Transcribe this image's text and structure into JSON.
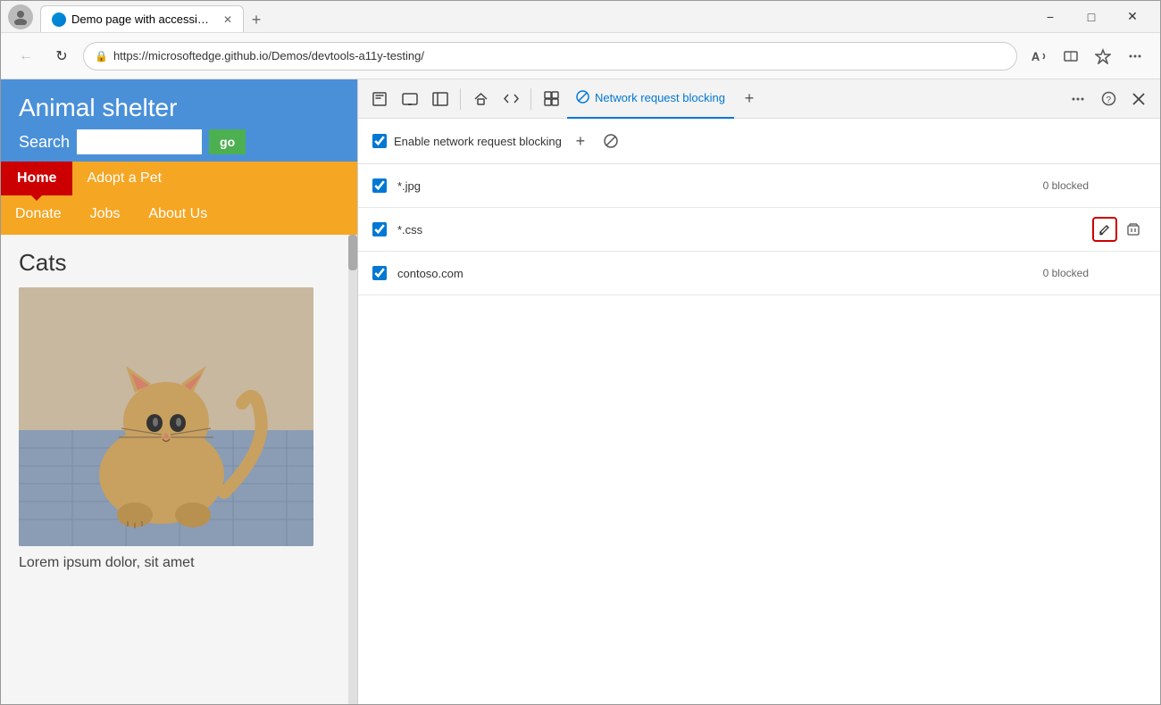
{
  "window": {
    "title": "Demo page with accessibility iss",
    "controls": {
      "minimize": "−",
      "maximize": "□",
      "close": "✕"
    }
  },
  "tab": {
    "label": "Demo page with accessibility iss",
    "close": "✕"
  },
  "addressbar": {
    "url": "https://microsoftedge.github.io/Demos/devtools-a11y-testing/",
    "back_disabled": false,
    "refresh": "↻"
  },
  "webpage": {
    "title": "Animal shelter",
    "search_label": "Search",
    "search_placeholder": "",
    "search_btn": "go",
    "nav": {
      "home": "Home",
      "adopt": "Adopt a Pet",
      "donate": "Donate",
      "jobs": "Jobs",
      "about": "About Us"
    },
    "section_title": "Cats",
    "lorem_text": "Lorem ipsum dolor, sit amet"
  },
  "devtools": {
    "panel_title": "Network request blocking",
    "icons": {
      "inspect": "⬚",
      "device": "⊡",
      "toggle_sidebar": "▭",
      "home": "⌂",
      "source": "</>",
      "elements": "⊞",
      "circle_slash": "⊘"
    },
    "tabs_more": "⋯",
    "help": "?",
    "close": "✕",
    "add_tab": "+"
  },
  "nrb": {
    "enable_label": "Enable network request blocking",
    "add_btn": "+",
    "clear_btn": "⊘",
    "rules": [
      {
        "id": "rule-jpg",
        "checked": true,
        "text": "*.jpg",
        "blocked_count": "0 blocked",
        "show_blocked": true,
        "show_actions": false
      },
      {
        "id": "rule-css",
        "checked": true,
        "text": "*.css",
        "blocked_count": "",
        "show_blocked": false,
        "show_actions": true
      },
      {
        "id": "rule-contoso",
        "checked": true,
        "text": "contoso.com",
        "blocked_count": "0 blocked",
        "show_blocked": true,
        "show_actions": false
      }
    ]
  }
}
